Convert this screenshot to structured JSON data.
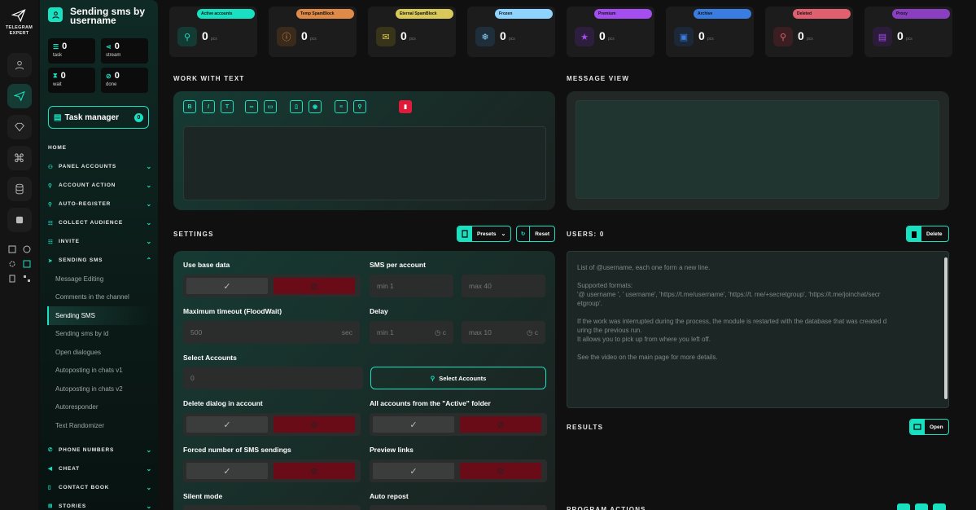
{
  "app": {
    "brand": [
      "TELEGRAM",
      "EXPERT"
    ],
    "module_title": "Sending sms by username"
  },
  "stats": [
    {
      "value": "0",
      "label": "task",
      "icon": "list-icon"
    },
    {
      "value": "0",
      "label": "stream",
      "icon": "share-icon"
    },
    {
      "value": "0",
      "label": "wait",
      "icon": "hourglass-icon"
    },
    {
      "value": "0",
      "label": "done",
      "icon": "check-circle-icon"
    }
  ],
  "task_manager": {
    "label": "Task manager",
    "badge": "0"
  },
  "menu": {
    "home": "HOME",
    "items": [
      {
        "label": "PANEL ACCOUNTS",
        "icon": "users-icon"
      },
      {
        "label": "ACCOUNT ACTION",
        "icon": "user-icon"
      },
      {
        "label": "AUTO-REGISTER",
        "icon": "user-plus-icon"
      },
      {
        "label": "COLLECT AUDIENCE",
        "icon": "user-list-icon"
      },
      {
        "label": "INVITE",
        "icon": "user-list-icon"
      },
      {
        "label": "SENDING SMS",
        "icon": "send-icon"
      }
    ],
    "sub_items": [
      "Message Editing",
      "Comments in the channel",
      "Sending SMS",
      "Sending sms by id",
      "Open dialogues",
      "Autoposting in chats v1",
      "Autoposting in chats v2",
      "Autoresponder",
      "Text Randomizer"
    ],
    "active_sub": "Sending SMS",
    "bottom_items": [
      {
        "label": "PHONE NUMBERS",
        "icon": "phone-icon"
      },
      {
        "label": "CHEAT",
        "icon": "megaphone-icon"
      },
      {
        "label": "CONTACT BOOK",
        "icon": "book-icon"
      },
      {
        "label": "STORIES",
        "icon": "plus-square-icon"
      }
    ]
  },
  "counters": [
    {
      "label": "Active accounts",
      "value": "0",
      "unit": "pcs",
      "color": "#19e0c0",
      "icon": "user-check-icon"
    },
    {
      "label": "Temp SpamBlock",
      "value": "0",
      "unit": "pcs",
      "color": "#e08a4a",
      "icon": "warning-icon"
    },
    {
      "label": "Eternal SpamBlock",
      "value": "0",
      "unit": "pcs",
      "color": "#d8c95a",
      "icon": "mail-block-icon"
    },
    {
      "label": "Frozen",
      "value": "0",
      "unit": "pcs",
      "color": "#8fd4ff",
      "icon": "snowflake-icon"
    },
    {
      "label": "Premium",
      "value": "0",
      "unit": "pcs",
      "color": "#a44ef0",
      "icon": "star-icon"
    },
    {
      "label": "Archive",
      "value": "0",
      "unit": "pcs",
      "color": "#3a7de0",
      "icon": "archive-icon"
    },
    {
      "label": "Deleted",
      "value": "0",
      "unit": "pcs",
      "color": "#e06070",
      "icon": "user-x-icon"
    },
    {
      "label": "Proxy",
      "value": "0",
      "unit": "pcs",
      "color": "#8a3ec0",
      "icon": "proxy-icon"
    }
  ],
  "sections": {
    "work_with_text": "WORK WITH TEXT",
    "message_view": "MESSAGE VIEW",
    "settings": "SETTINGS",
    "users": "USERS: 0",
    "results": "RESULTS",
    "program_actions": "PROGRAM ACTIONS"
  },
  "buttons": {
    "presets": "Presets",
    "reset": "Reset",
    "delete": "Delete",
    "open": "Open",
    "select_accounts": "Select Accounts"
  },
  "toolbar": [
    "B",
    "I",
    "T"
  ],
  "settings": {
    "use_base_data": "Use base data",
    "sms_per_account": "SMS per account",
    "sms_min": "min  1",
    "sms_max": "max  40",
    "max_timeout": "Maximum timeout (FloodWait)",
    "timeout_value": "500",
    "timeout_unit": "sec",
    "delay": "Delay",
    "delay_min": "min  1",
    "delay_max": "max  10",
    "delay_unit": "c",
    "select_accounts": "Select Accounts",
    "select_accounts_value": "0",
    "delete_dialog": "Delete dialog in account",
    "all_active_folder": "All accounts from the \"Active\" folder",
    "forced_sms": "Forced number of SMS sendings",
    "preview_links": "Preview links",
    "silent_mode": "Silent mode",
    "auto_repost": "Auto repost"
  },
  "users_hint": [
    "List of @username, each one form a new line.",
    "",
    "Supported formats:",
    "'@ username ', ' username', 'https://t.me/username', 'https://t. me/+secretgroup', 'https://t.me/joinchat/secr",
    "etgroup'.",
    "",
    "If the work was interrupted during the process, the module is restarted with the database that was created d",
    "uring the previous run.",
    "It allows you to pick up from where you left off.",
    "",
    "See the video on the main page for more details."
  ]
}
